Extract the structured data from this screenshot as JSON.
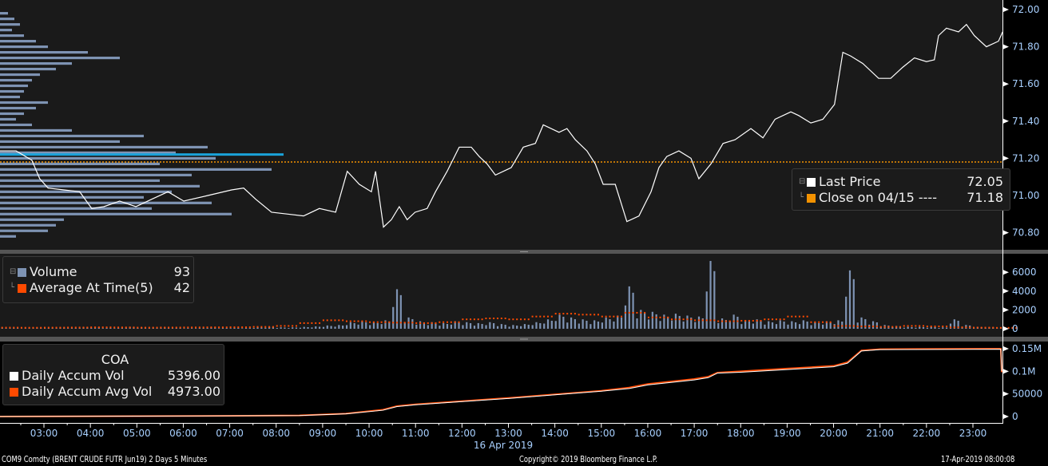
{
  "colors": {
    "price": "#ffffff",
    "close": "#f39200",
    "volume": "#7e93b3",
    "average": "#ff4a00",
    "accum": "#ffffff",
    "accum_avg": "#ff4a00",
    "profile": "#7e93b3",
    "profile_highlight": "#1aa3d9",
    "axis_text": "#a8d0ff"
  },
  "price_legend": {
    "last_label": "Last Price",
    "last_value": "72.05",
    "close_label": "Close on 04/15 ----",
    "close_value": "71.18"
  },
  "volume_legend": {
    "volume_label": "Volume",
    "volume_value": "93",
    "avg_label": "Average At Time(5)",
    "avg_value": "42"
  },
  "accum_legend": {
    "title": "COA",
    "accum_label": "Daily Accum Vol",
    "accum_value": "5396.00",
    "avg_label": "Daily Accum Avg Vol",
    "avg_value": "4973.00"
  },
  "footer": {
    "security": "COM9 Comdty (BRENT CRUDE FUTR  Jun19) 2 Days 5 Minutes",
    "copyright": "Copyright© 2019 Bloomberg Finance L.P.",
    "timestamp": "17-Apr-2019 08:00:08"
  },
  "chart_data": [
    {
      "type": "line",
      "title": "Last Price",
      "xlabel": "16 Apr 2019",
      "x_unit": "hour",
      "xlim": [
        2.05,
        23.65
      ],
      "ylim": [
        70.75,
        72.05
      ],
      "x_ticks": [
        "03:00",
        "04:00",
        "05:00",
        "06:00",
        "07:00",
        "08:00",
        "09:00",
        "10:00",
        "11:00",
        "12:00",
        "13:00",
        "14:00",
        "15:00",
        "16:00",
        "17:00",
        "18:00",
        "19:00",
        "20:00",
        "21:00",
        "22:00",
        "23:00"
      ],
      "y_ticks": [
        "72.00",
        "71.80",
        "71.60",
        "71.40",
        "71.20",
        "71.00",
        "70.80"
      ],
      "close_line": 71.18,
      "x": [
        2.05,
        2.4,
        2.74,
        2.91,
        3.09,
        3.43,
        3.77,
        4.03,
        4.29,
        4.63,
        4.98,
        5.32,
        5.67,
        6.01,
        6.53,
        7.04,
        7.3,
        7.56,
        7.9,
        8.25,
        8.59,
        8.93,
        9.28,
        9.53,
        9.79,
        10.05,
        10.14,
        10.31,
        10.48,
        10.65,
        10.82,
        10.99,
        11.25,
        11.43,
        11.68,
        11.94,
        12.2,
        12.37,
        12.54,
        12.72,
        13.06,
        13.32,
        13.58,
        13.75,
        14.09,
        14.26,
        14.44,
        14.69,
        14.87,
        15.04,
        15.3,
        15.55,
        15.81,
        16.07,
        16.24,
        16.41,
        16.67,
        16.93,
        17.1,
        17.36,
        17.62,
        17.88,
        18.22,
        18.48,
        18.74,
        19.08,
        19.25,
        19.51,
        19.77,
        20.02,
        20.2,
        20.37,
        20.63,
        20.97,
        21.23,
        21.49,
        21.74,
        22.0,
        22.17,
        22.26,
        22.43,
        22.69,
        22.86,
        23.03,
        23.29,
        23.55,
        23.64
      ],
      "y": [
        71.24,
        71.24,
        71.19,
        71.09,
        71.04,
        71.03,
        71.02,
        70.93,
        70.94,
        70.97,
        70.94,
        70.98,
        71.02,
        70.97,
        71.0,
        71.03,
        71.04,
        70.98,
        70.91,
        70.9,
        70.89,
        70.93,
        70.91,
        71.13,
        71.06,
        71.02,
        71.13,
        70.83,
        70.87,
        70.94,
        70.87,
        70.91,
        70.93,
        71.02,
        71.13,
        71.26,
        71.26,
        71.21,
        71.17,
        71.11,
        71.15,
        71.26,
        71.28,
        71.38,
        71.34,
        71.36,
        71.3,
        71.24,
        71.17,
        71.06,
        71.06,
        70.86,
        70.89,
        71.02,
        71.15,
        71.21,
        71.24,
        71.2,
        71.09,
        71.17,
        71.28,
        71.3,
        71.36,
        71.31,
        71.41,
        71.45,
        71.43,
        71.39,
        71.41,
        71.49,
        71.77,
        71.75,
        71.71,
        71.63,
        71.63,
        71.69,
        71.74,
        71.72,
        71.73,
        71.86,
        71.9,
        71.88,
        71.92,
        71.86,
        71.8,
        71.83,
        71.88
      ],
      "volume_profile": {
        "prices": [
          71.98,
          71.95,
          71.92,
          71.89,
          71.86,
          71.83,
          71.8,
          71.77,
          71.74,
          71.71,
          71.68,
          71.65,
          71.62,
          71.59,
          71.56,
          71.53,
          71.5,
          71.47,
          71.44,
          71.41,
          71.38,
          71.35,
          71.32,
          71.29,
          71.26,
          71.23,
          71.22,
          71.2,
          71.17,
          71.14,
          71.11,
          71.08,
          71.05,
          71.02,
          70.99,
          70.96,
          70.93,
          70.9,
          70.87,
          70.84,
          70.81,
          70.78
        ],
        "values": [
          10,
          18,
          25,
          15,
          30,
          45,
          60,
          110,
          150,
          90,
          70,
          50,
          40,
          35,
          30,
          25,
          60,
          45,
          30,
          20,
          40,
          90,
          180,
          150,
          260,
          220,
          355,
          270,
          200,
          340,
          240,
          200,
          250,
          215,
          180,
          265,
          190,
          290,
          80,
          70,
          60,
          20
        ],
        "highlight_price": 71.22
      }
    },
    {
      "type": "bar",
      "title": "Volume",
      "ylim": [
        0,
        7500
      ],
      "y_ticks": [
        "6000",
        "4000",
        "2000",
        "0"
      ],
      "x_unit": "hour",
      "x_start": 2.0,
      "x_step": 0.25,
      "values": [
        100,
        80,
        60,
        100,
        80,
        120,
        90,
        150,
        200,
        120,
        100,
        200,
        150,
        100,
        120,
        100,
        80,
        100,
        150,
        100,
        120,
        100,
        150,
        200,
        150,
        150,
        200,
        250,
        350,
        400,
        700,
        800,
        700,
        900,
        4200,
        1200,
        800,
        700,
        600,
        800,
        700,
        600,
        700,
        500,
        400,
        500,
        700,
        1000,
        1500,
        1200,
        1000,
        900,
        1200,
        1400,
        4500,
        2000,
        1800,
        1500,
        1600,
        1400,
        1300,
        7200,
        1100,
        1500,
        900,
        1000,
        800,
        900,
        800,
        900,
        700,
        800,
        900,
        6200,
        1200,
        800,
        400,
        300,
        200,
        200,
        200,
        150,
        1000,
        400,
        200,
        150,
        100,
        93
      ],
      "average_x_step": 0.5,
      "average": [
        120,
        110,
        120,
        130,
        150,
        140,
        120,
        130,
        140,
        150,
        160,
        200,
        300,
        600,
        900,
        800,
        700,
        650,
        600,
        700,
        1000,
        1100,
        1000,
        1300,
        1600,
        1500,
        1300,
        1700,
        1200,
        1000,
        900,
        800,
        850,
        1000,
        1300,
        700,
        300,
        250,
        200,
        300,
        250,
        150,
        120,
        100
      ]
    },
    {
      "type": "line",
      "title": "COA",
      "ylim": [
        -10000,
        165000
      ],
      "y_ticks": [
        "0.15M",
        "0.1M",
        "50000",
        "0"
      ],
      "x_unit": "hour",
      "series": [
        {
          "name": "Daily Accum Vol",
          "x": [
            2.0,
            5.0,
            7.0,
            8.5,
            9.5,
            10.3,
            10.6,
            11.0,
            12.0,
            13.0,
            14.0,
            15.0,
            15.6,
            16.0,
            17.0,
            17.3,
            17.5,
            18.0,
            19.0,
            20.0,
            20.3,
            20.6,
            21.0,
            23.6,
            23.62
          ],
          "y": [
            0,
            800,
            1500,
            2200,
            6000,
            14000,
            22000,
            26000,
            33000,
            40000,
            48000,
            56000,
            62000,
            70000,
            81000,
            86000,
            96000,
            98000,
            104000,
            110000,
            118000,
            145000,
            148000,
            149000,
            100000
          ]
        },
        {
          "name": "Daily Accum Avg Vol",
          "x": [
            2.0,
            5.0,
            7.0,
            8.5,
            9.5,
            10.3,
            10.6,
            11.0,
            12.0,
            13.0,
            14.0,
            15.0,
            15.6,
            16.0,
            17.0,
            17.3,
            17.5,
            18.0,
            19.0,
            20.0,
            20.3,
            20.6,
            21.0,
            23.6,
            23.62
          ],
          "y": [
            0,
            900,
            1600,
            2500,
            6500,
            15000,
            23000,
            27000,
            34000,
            41000,
            49000,
            57000,
            64000,
            72000,
            83000,
            88000,
            97000,
            100000,
            106000,
            112000,
            120000,
            146000,
            149000,
            150000,
            98000
          ]
        }
      ]
    }
  ]
}
